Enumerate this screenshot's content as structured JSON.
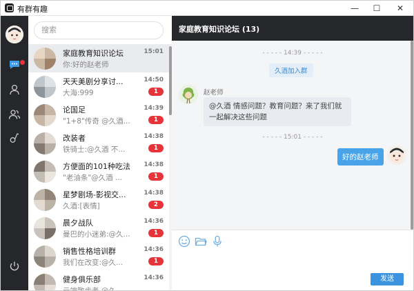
{
  "app": {
    "title": "有群有趣"
  },
  "window_controls": {
    "minimize": "—",
    "maximize": "☐",
    "close": "✕"
  },
  "search": {
    "placeholder": "搜索"
  },
  "conversations": [
    {
      "name": "家庭教育知识论坛",
      "preview": "你:好的赵老师",
      "time": "15:01",
      "badge": "",
      "active": true
    },
    {
      "name": "天天美剧分享讨...",
      "preview": "大海:999",
      "time": "14:50",
      "badge": "1"
    },
    {
      "name": "论国足",
      "preview": "\"1+8\"传奇 @久酒...",
      "time": "14:39",
      "badge": "1"
    },
    {
      "name": "改装者",
      "preview": "铁骑士:@久酒 不...",
      "time": "14:38",
      "badge": "1"
    },
    {
      "name": "方便面的101种吃法",
      "preview": "\"老油条\"@久酒 ...",
      "time": "14:38",
      "badge": "1"
    },
    {
      "name": "星梦剧场-影视交...",
      "preview": "久酒:[表情]",
      "time": "14:38",
      "badge": "2"
    },
    {
      "name": "晨夕战队",
      "preview": "曼巴的小迷弟:@久...",
      "time": "14:36",
      "badge": "1"
    },
    {
      "name": "销售性格培训群",
      "preview": "我们在改变:@久...",
      "time": "14:36",
      "badge": "1"
    },
    {
      "name": "健身俱乐部",
      "preview": "云端散步者 @久...",
      "time": "14:36",
      "badge": ""
    }
  ],
  "chat": {
    "title": "家庭教育知识论坛 (13)",
    "divider1": "- - - - - 14:39 - - - - -",
    "system_notice": "久酒加入群",
    "sender": "赵老师",
    "incoming_message": "@久酒 情感问题？教育问题？来了我们就一起解决这些问题",
    "divider2": "- - - - - 15:01 - - - - -",
    "outgoing_message": "好的赵老师",
    "send_label": "发送"
  },
  "colors": {
    "rail": "#26272b",
    "badge": "#e6343a",
    "accent": "#48a3e8"
  }
}
